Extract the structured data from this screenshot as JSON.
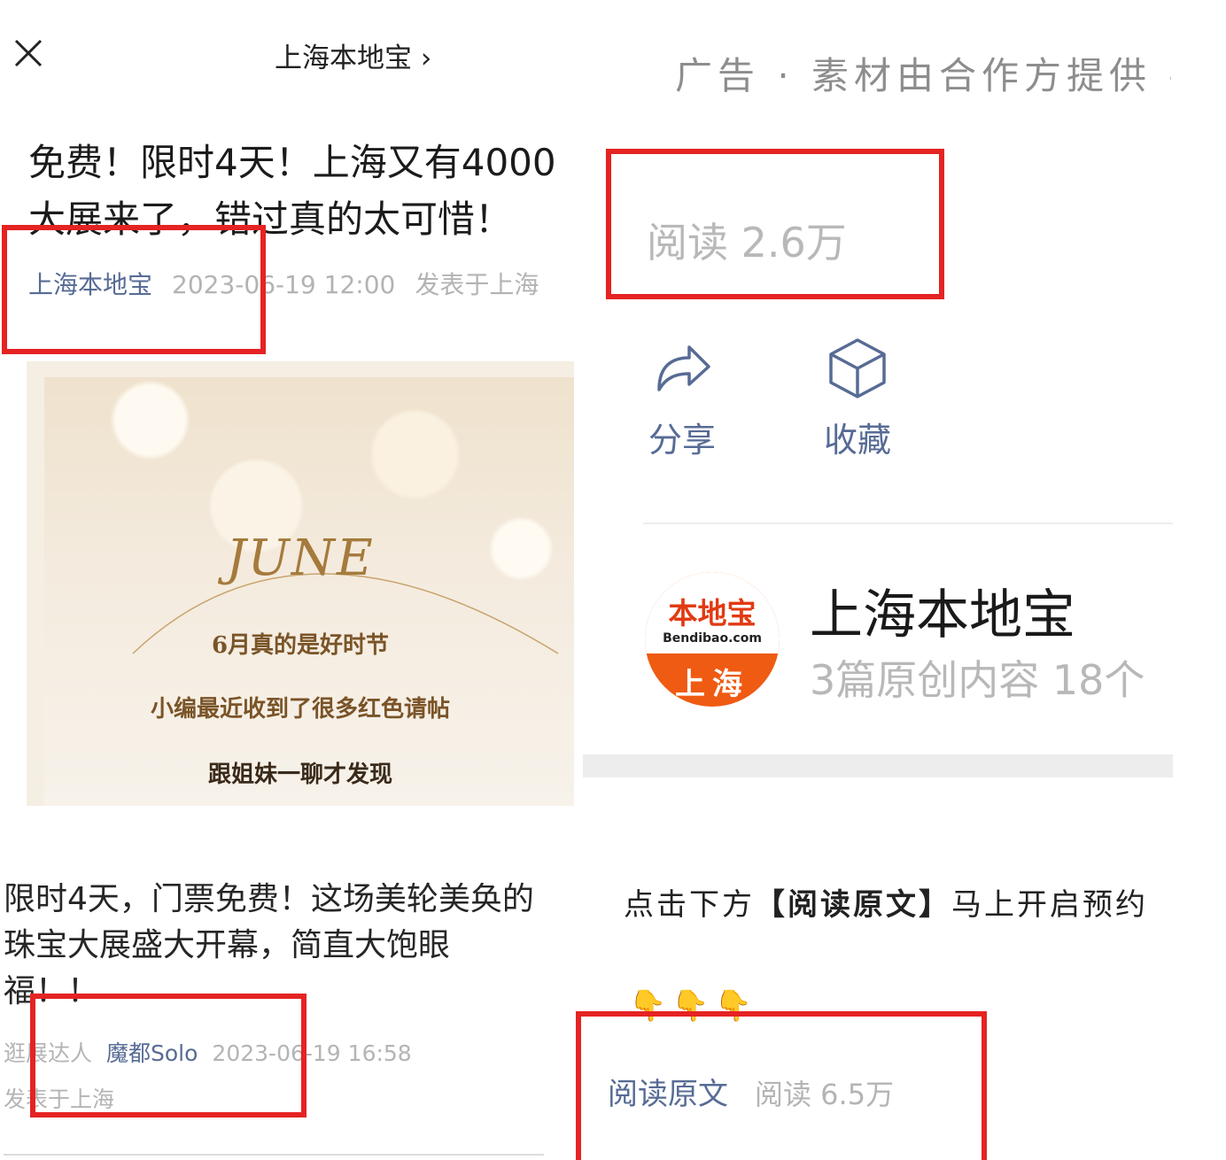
{
  "header": {
    "close_icon": "close-icon",
    "account_link": "上海本地宝 ›",
    "ad_note": "广告 · 素材由合作方提供 -"
  },
  "article": {
    "title_line1": "免费！限时4天！上海又有4000",
    "title_line2": "大展来了，错过真的太可惜！",
    "account": "上海本地宝",
    "date": "2023-06-19 12:00",
    "location": "发表于上海",
    "cover": {
      "heading": "JUNE",
      "line1": "6月真的是好时节",
      "line2": "小编最近收到了很多红色请帖",
      "line3": "跟姐妹一聊才发现"
    },
    "read_count": "阅读 2.6万"
  },
  "actions": {
    "share_label": "分享",
    "favorite_label": "收藏"
  },
  "profile": {
    "avatar_logo": "本地宝",
    "avatar_domain": "Bendibao.com",
    "avatar_city": "上海",
    "name": "上海本地宝",
    "stats": "3篇原创内容  18个"
  },
  "second_article": {
    "title": "限时4天，门票免费！这场美轮美奂的珠宝大展盛大开幕，简直大饱眼福！！",
    "author_tag": "逛展达人",
    "account": "魔都Solo",
    "date": "2023-06-19 16:58",
    "location": "发表于上海"
  },
  "cta": {
    "prefix": "点击下方",
    "highlight": "【阅读原文】",
    "suffix": "马上开启预约",
    "hands": "👇👇👇",
    "read_original": "阅读原文",
    "read_count": "阅读 6.5万"
  },
  "colors": {
    "link_blue": "#576b95",
    "highlight_red": "#e52323",
    "avatar_orange": "#ef5b12"
  }
}
